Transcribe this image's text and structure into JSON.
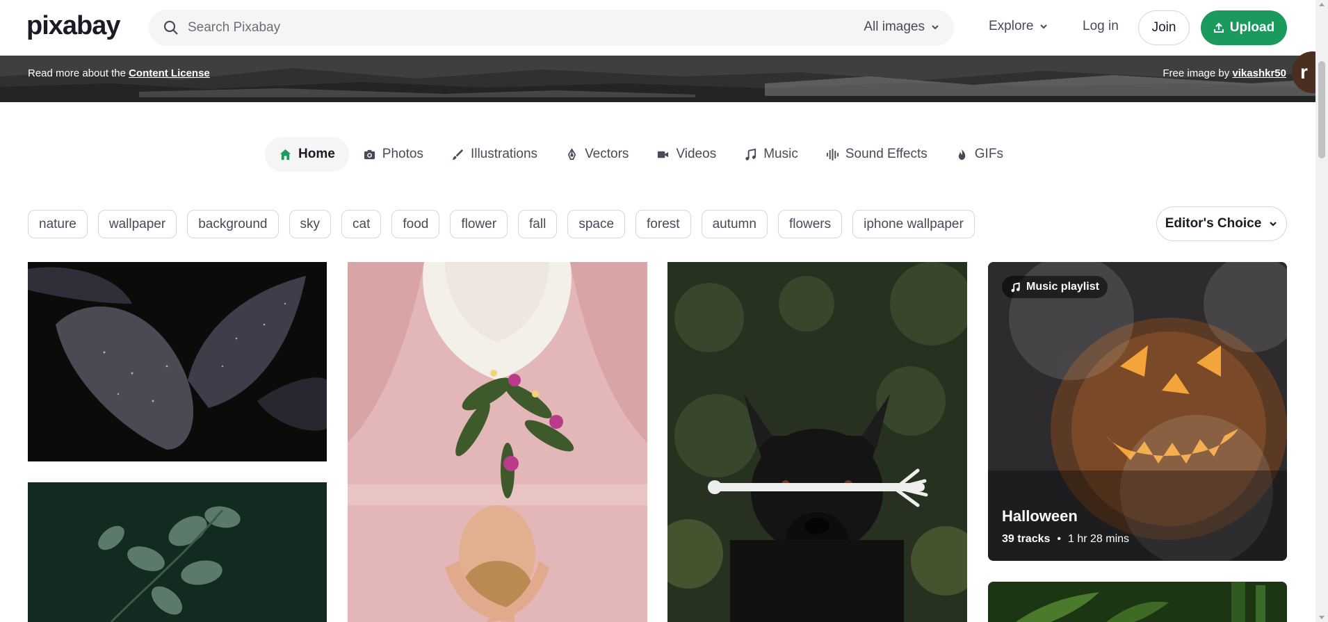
{
  "brand": {
    "logo_text": "pixabay",
    "accent": "#1a9a5c"
  },
  "search": {
    "placeholder": "Search Pixabay",
    "filter_label": "All images"
  },
  "nav": {
    "explore": "Explore",
    "login": "Log in",
    "join": "Join",
    "upload": "Upload"
  },
  "hero": {
    "license_prefix": "Read more about the ",
    "license_link": "Content License",
    "credit_prefix": "Free image by ",
    "credit_user": "vikashkr50",
    "avatar_letter": "r"
  },
  "tabs": [
    {
      "label": "Home",
      "icon": "home-icon",
      "active": true
    },
    {
      "label": "Photos",
      "icon": "camera-icon"
    },
    {
      "label": "Illustrations",
      "icon": "brush-icon"
    },
    {
      "label": "Vectors",
      "icon": "pen-nib-icon"
    },
    {
      "label": "Videos",
      "icon": "video-icon"
    },
    {
      "label": "Music",
      "icon": "music-note-icon"
    },
    {
      "label": "Sound Effects",
      "icon": "waveform-icon"
    },
    {
      "label": "GIFs",
      "icon": "flame-icon"
    }
  ],
  "tags": [
    "nature",
    "wallpaper",
    "background",
    "sky",
    "cat",
    "food",
    "flower",
    "fall",
    "space",
    "forest",
    "autumn",
    "flowers",
    "iphone wallpaper"
  ],
  "sort": {
    "label": "Editor's Choice"
  },
  "playlist": {
    "badge": "Music playlist",
    "title": "Halloween",
    "tracks": "39 tracks",
    "duration": "1 hr 28 mins"
  }
}
